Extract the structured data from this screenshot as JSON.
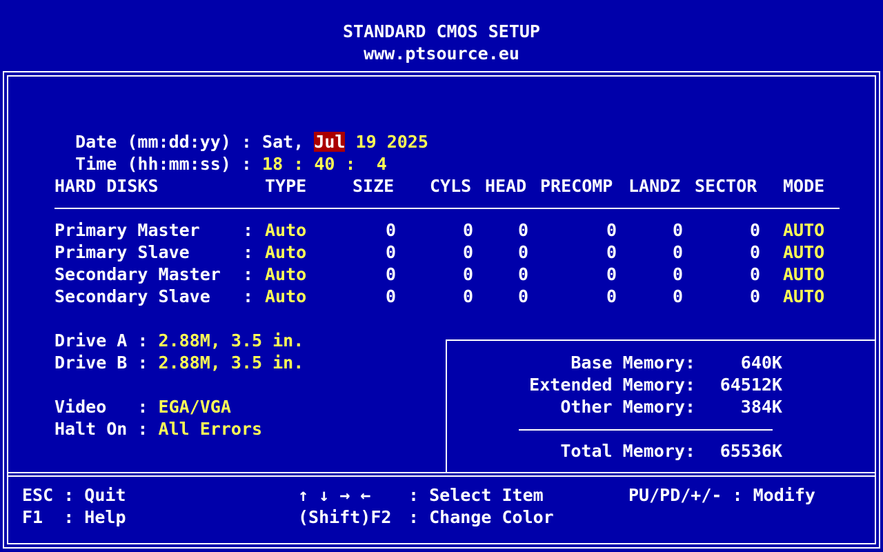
{
  "header": {
    "title": "STANDARD CMOS SETUP",
    "subtitle": "www.ptsource.eu"
  },
  "datetime": {
    "date_label": "Date (mm:dd:yy) :",
    "date_weekday": "Sat,",
    "date_month": "Jul",
    "date_day_year": "19 2025",
    "time_label": "Time (hh:mm:ss) :",
    "time_hh": "18",
    "time_sep1": ":",
    "time_mm": "40",
    "time_sep2": ":",
    "time_ss": "4"
  },
  "disk_table": {
    "headers": [
      "HARD DISKS",
      "TYPE",
      "SIZE",
      "CYLS",
      "HEAD",
      "PRECOMP",
      "LANDZ",
      "SECTOR",
      "MODE"
    ],
    "rows": [
      {
        "name": "Primary Master",
        "type": "Auto",
        "size": "0",
        "cyls": "0",
        "head": "0",
        "precomp": "0",
        "landz": "0",
        "sector": "0",
        "mode": "AUTO"
      },
      {
        "name": "Primary Slave",
        "type": "Auto",
        "size": "0",
        "cyls": "0",
        "head": "0",
        "precomp": "0",
        "landz": "0",
        "sector": "0",
        "mode": "AUTO"
      },
      {
        "name": "Secondary Master",
        "type": "Auto",
        "size": "0",
        "cyls": "0",
        "head": "0",
        "precomp": "0",
        "landz": "0",
        "sector": "0",
        "mode": "AUTO"
      },
      {
        "name": "Secondary Slave",
        "type": "Auto",
        "size": "0",
        "cyls": "0",
        "head": "0",
        "precomp": "0",
        "landz": "0",
        "sector": "0",
        "mode": "AUTO"
      }
    ],
    "separator": ":"
  },
  "drives": {
    "drive_a_label": "Drive A :",
    "drive_a_value": "2.88M, 3.5 in.",
    "drive_b_label": "Drive B :",
    "drive_b_value": "2.88M, 3.5 in."
  },
  "system": {
    "video_label": "Video   :",
    "video_value": "EGA/VGA",
    "halt_label": "Halt On :",
    "halt_value": "All Errors"
  },
  "memory": {
    "base_label": "Base Memory:",
    "base_value": "640K",
    "extended_label": "Extended Memory:",
    "extended_value": "64512K",
    "other_label": "Other Memory:",
    "other_value": "384K",
    "total_label": "Total Memory:",
    "total_value": "65536K"
  },
  "footer": {
    "esc_key": "ESC : Quit",
    "f1_key": "F1  : Help",
    "arrows_key": "↑ ↓ → ←",
    "select_text": ": Select Item",
    "shift_f2_key": "(Shift)F2",
    "change_color_text": ": Change Color",
    "modify_text": "PU/PD/+/- : Modify"
  },
  "colors": {
    "background": "#0000aa",
    "text": "#ffffff",
    "value": "#ffff55",
    "highlight": "#aa0000"
  }
}
